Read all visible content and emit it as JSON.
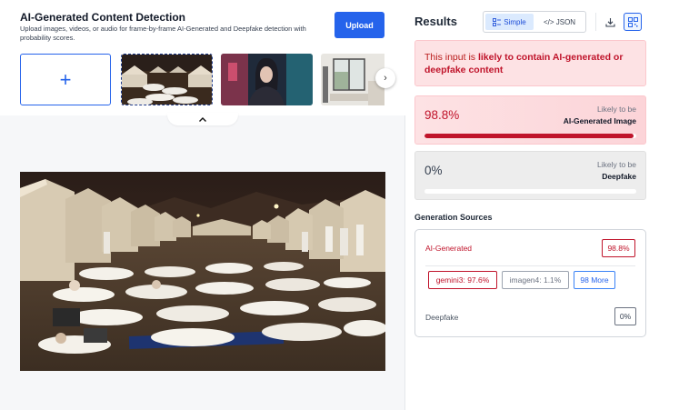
{
  "header": {
    "title": "AI-Generated Content Detection",
    "subtitle": "Upload images, videos, or audio for frame-by-frame AI-Generated and Deepfake detection with probability scores.",
    "upload_label": "Upload"
  },
  "gallery": {
    "add_symbol": "+",
    "next_symbol": "›",
    "collapse_symbol": "^"
  },
  "results": {
    "title": "Results",
    "view_toggle": {
      "simple": "Simple",
      "json": "</> JSON",
      "active": "simple"
    },
    "verdict_prefix": "This input is ",
    "verdict_highlight": "likely to contain AI-generated or deepfake content",
    "ai_card": {
      "percent": "98.8%",
      "likely": "Likely to be",
      "category": "AI-Generated Image",
      "fill_fraction": 0.988
    },
    "deepfake_card": {
      "percent": "0%",
      "likely": "Likely to be",
      "category": "Deepfake",
      "fill_fraction": 0.0
    },
    "generation_sources": {
      "title": "Generation Sources",
      "ai_label": "AI-Generated",
      "ai_score": "98.8%",
      "chips": [
        "gemini3: 97.6%",
        "imagen4: 1.1%",
        "98 More"
      ],
      "deepfake_label": "Deepfake",
      "deepfake_score": "0%"
    }
  },
  "colors": {
    "accent": "#2563eb",
    "danger": "#c0142b",
    "danger_bg": "#fde2e4"
  },
  "icons": [
    "plus-icon",
    "chevron-right-icon",
    "chevron-up-icon",
    "simple-view-icon",
    "code-icon",
    "download-icon",
    "qr-code-icon"
  ]
}
